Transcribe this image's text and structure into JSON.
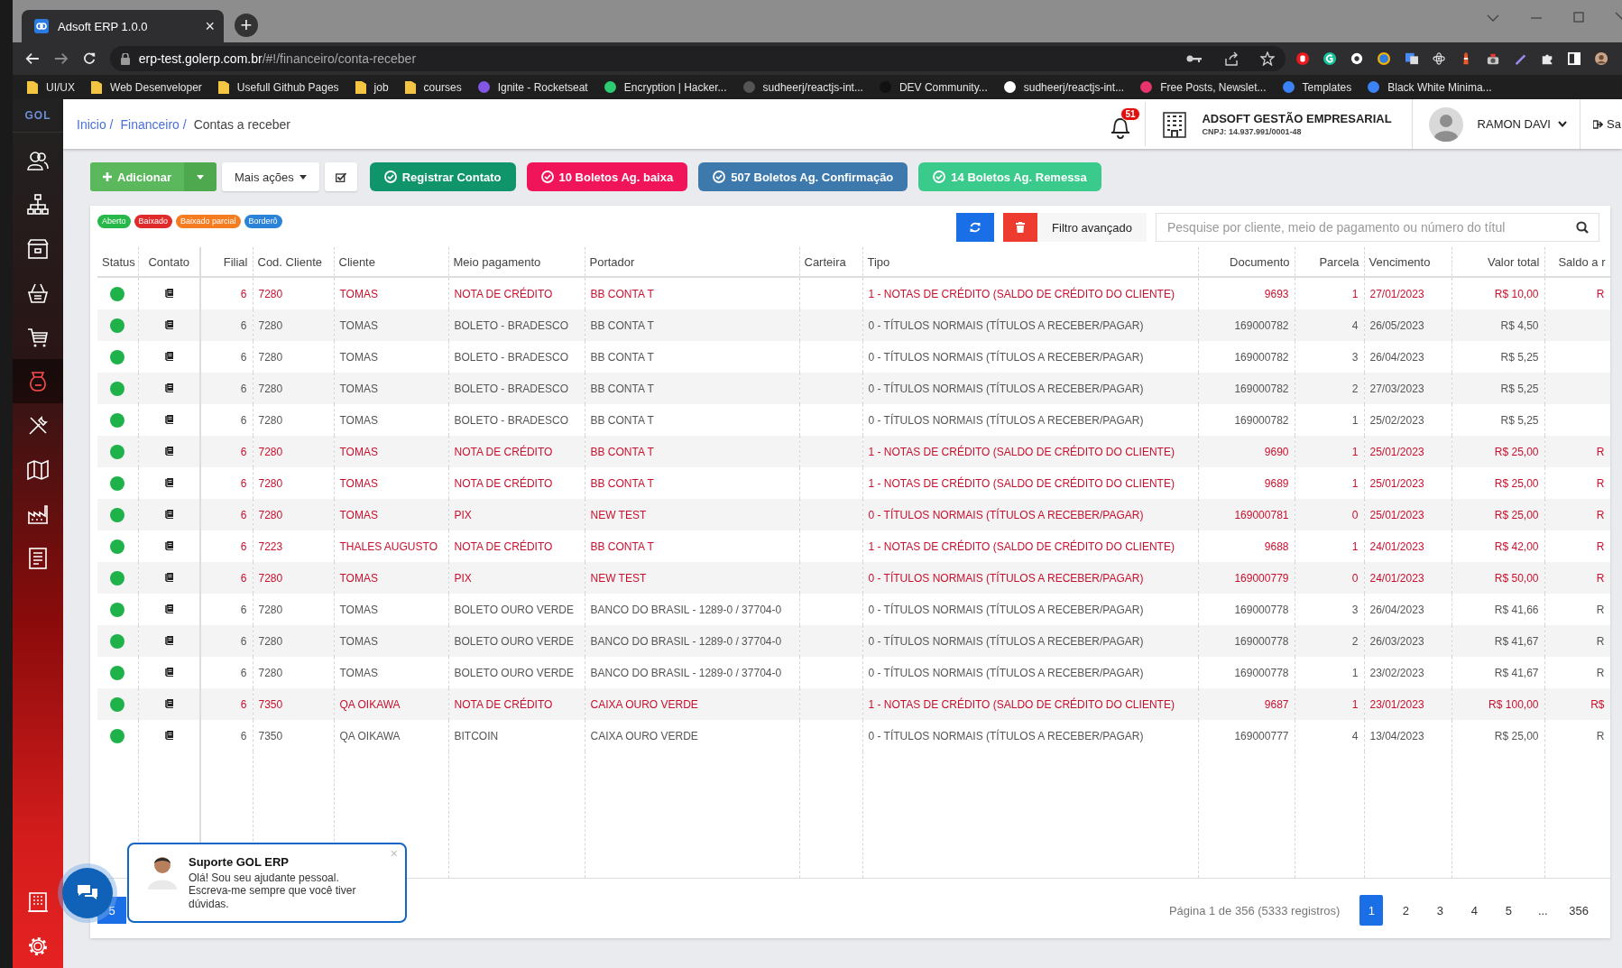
{
  "browser": {
    "tab_title": "Adsoft ERP 1.0.0",
    "tab_close": "×",
    "new_tab": "+",
    "url_host": "erp-test.golerp.com.br",
    "url_path": "/#!/financeiro/conta-receber",
    "bookmarks": [
      {
        "label": "UI/UX",
        "kind": "folder"
      },
      {
        "label": "Web Desenveloper",
        "kind": "folder"
      },
      {
        "label": "Usefull Github Pages",
        "kind": "folder"
      },
      {
        "label": "job",
        "kind": "folder"
      },
      {
        "label": "courses",
        "kind": "folder"
      },
      {
        "label": "Ignite - Rocketseat",
        "kind": "site",
        "color": "#8257e5"
      },
      {
        "label": "Encryption | Hacker...",
        "kind": "site",
        "color": "#2ecc71"
      },
      {
        "label": "sudheerj/reactjs-int...",
        "kind": "site",
        "color": "#555555"
      },
      {
        "label": "DEV Community...",
        "kind": "site",
        "color": "#111111"
      },
      {
        "label": "sudheerj/reactjs-int...",
        "kind": "site",
        "color": "#ffffff"
      },
      {
        "label": "Free Posts, Newslet...",
        "kind": "site",
        "color": "#e8336d"
      },
      {
        "label": "Templates",
        "kind": "site",
        "color": "#3b82f6"
      },
      {
        "label": "Black White Minima...",
        "kind": "site",
        "color": "#3b82f6"
      }
    ]
  },
  "sidebar": {
    "logo": "GOL",
    "items": [
      {
        "selected": false
      },
      {
        "selected": false
      },
      {
        "selected": false
      },
      {
        "selected": false
      },
      {
        "selected": false
      },
      {
        "selected": true
      },
      {
        "selected": false
      },
      {
        "selected": false
      },
      {
        "selected": false
      },
      {
        "selected": false
      }
    ],
    "bottom_items": [
      {
        "selected": false
      },
      {
        "selected": false
      }
    ]
  },
  "breadcrumb": [
    {
      "label": "Inicio /",
      "link": true
    },
    {
      "label": "Financeiro /",
      "link": true
    },
    {
      "label": "Contas a receber",
      "link": false
    }
  ],
  "header": {
    "notifications": "51",
    "company": "ADSOFT GESTÃO EMPRESARIAL",
    "cnpj": "CNPJ: 14.937.991/0001-48",
    "user": "RAMON DAVI",
    "logout": "Sa"
  },
  "toolbar": [
    {
      "label": "Adicionar",
      "kind": "split"
    },
    {
      "label": "Mais ações",
      "kind": "menu"
    },
    {
      "kind": "check"
    },
    {
      "label": "Registrar Contato",
      "kind": "action",
      "color": "#10956b"
    },
    {
      "label": "10 Boletos Ag. baixa",
      "kind": "action",
      "color": "#f0145a"
    },
    {
      "label": "507 Boletos Ag. Confirmação",
      "kind": "action",
      "color": "#3d79ac"
    },
    {
      "label": "14 Boletos Ag. Remessa",
      "kind": "action",
      "color": "#3acb8c"
    }
  ],
  "legend": [
    {
      "label": "Aberto",
      "color": "#28b84a"
    },
    {
      "label": "Baixado",
      "color": "#e02b2b"
    },
    {
      "label": "Baixado parcial",
      "color": "#f57c1f"
    },
    {
      "label": "Borderô",
      "color": "#2a83d6"
    }
  ],
  "filter": {
    "advanced": "Filtro avançado",
    "placeholder": "Pesquise por cliente, meio de pagamento ou número do títul"
  },
  "table": {
    "columns": [
      "Status",
      "Contato",
      "Filial",
      "Cod. Cliente",
      "Cliente",
      "Meio pagamento",
      "Portador",
      "Carteira",
      "Tipo",
      "Documento",
      "Parcela",
      "Vencimento",
      "Valor total",
      "Saldo a r"
    ],
    "rows": [
      {
        "color": "#1fb14a",
        "overdue": true,
        "filial": "6",
        "cod": "7280",
        "cliente": "TOMAS",
        "meio": "NOTA DE CRÉDITO",
        "portador": "BB CONTA T",
        "tipo": "1 - NOTAS DE CRÉDITO (SALDO DE CRÉDITO DO CLIENTE)",
        "documento": "9693",
        "parcela": "1",
        "vencimento": "27/01/2023",
        "valor": "R$ 10,00",
        "saldo": "R"
      },
      {
        "color": "#1fb14a",
        "overdue": false,
        "filial": "6",
        "cod": "7280",
        "cliente": "TOMAS",
        "meio": "BOLETO - BRADESCO",
        "portador": "BB CONTA T",
        "tipo": "0 - TÍTULOS NORMAIS (TÍTULOS A RECEBER/PAGAR)",
        "documento": "169000782",
        "parcela": "4",
        "vencimento": "26/05/2023",
        "valor": "R$ 4,50"
      },
      {
        "color": "#1fb14a",
        "overdue": false,
        "filial": "6",
        "cod": "7280",
        "cliente": "TOMAS",
        "meio": "BOLETO - BRADESCO",
        "portador": "BB CONTA T",
        "tipo": "0 - TÍTULOS NORMAIS (TÍTULOS A RECEBER/PAGAR)",
        "documento": "169000782",
        "parcela": "3",
        "vencimento": "26/04/2023",
        "valor": "R$ 5,25"
      },
      {
        "color": "#1fb14a",
        "overdue": false,
        "filial": "6",
        "cod": "7280",
        "cliente": "TOMAS",
        "meio": "BOLETO - BRADESCO",
        "portador": "BB CONTA T",
        "tipo": "0 - TÍTULOS NORMAIS (TÍTULOS A RECEBER/PAGAR)",
        "documento": "169000782",
        "parcela": "2",
        "vencimento": "27/03/2023",
        "valor": "R$ 5,25"
      },
      {
        "color": "#1fb14a",
        "overdue": false,
        "filial": "6",
        "cod": "7280",
        "cliente": "TOMAS",
        "meio": "BOLETO - BRADESCO",
        "portador": "BB CONTA T",
        "tipo": "0 - TÍTULOS NORMAIS (TÍTULOS A RECEBER/PAGAR)",
        "documento": "169000782",
        "parcela": "1",
        "vencimento": "25/02/2023",
        "valor": "R$ 5,25"
      },
      {
        "color": "#1fb14a",
        "overdue": true,
        "filial": "6",
        "cod": "7280",
        "cliente": "TOMAS",
        "meio": "NOTA DE CRÉDITO",
        "portador": "BB CONTA T",
        "tipo": "1 - NOTAS DE CRÉDITO (SALDO DE CRÉDITO DO CLIENTE)",
        "documento": "9690",
        "parcela": "1",
        "vencimento": "25/01/2023",
        "valor": "R$ 25,00",
        "saldo": "R"
      },
      {
        "color": "#1fb14a",
        "overdue": true,
        "filial": "6",
        "cod": "7280",
        "cliente": "TOMAS",
        "meio": "NOTA DE CRÉDITO",
        "portador": "BB CONTA T",
        "tipo": "1 - NOTAS DE CRÉDITO (SALDO DE CRÉDITO DO CLIENTE)",
        "documento": "9689",
        "parcela": "1",
        "vencimento": "25/01/2023",
        "valor": "R$ 25,00",
        "saldo": "R"
      },
      {
        "color": "#1fb14a",
        "overdue": true,
        "filial": "6",
        "cod": "7280",
        "cliente": "TOMAS",
        "meio": "PIX",
        "portador": "NEW TEST",
        "tipo": "0 - TÍTULOS NORMAIS (TÍTULOS A RECEBER/PAGAR)",
        "documento": "169000781",
        "parcela": "0",
        "vencimento": "25/01/2023",
        "valor": "R$ 25,00",
        "saldo": "R"
      },
      {
        "color": "#1fb14a",
        "overdue": true,
        "filial": "6",
        "cod": "7223",
        "cliente": "THALES AUGUSTO",
        "meio": "NOTA DE CRÉDITO",
        "portador": "BB CONTA T",
        "tipo": "1 - NOTAS DE CRÉDITO (SALDO DE CRÉDITO DO CLIENTE)",
        "documento": "9688",
        "parcela": "1",
        "vencimento": "24/01/2023",
        "valor": "R$ 42,00",
        "saldo": "R"
      },
      {
        "color": "#1fb14a",
        "overdue": true,
        "filial": "6",
        "cod": "7280",
        "cliente": "TOMAS",
        "meio": "PIX",
        "portador": "NEW TEST",
        "tipo": "0 - TÍTULOS NORMAIS (TÍTULOS A RECEBER/PAGAR)",
        "documento": "169000779",
        "parcela": "0",
        "vencimento": "24/01/2023",
        "valor": "R$ 50,00",
        "saldo": "R"
      },
      {
        "color": "#1fb14a",
        "overdue": false,
        "filial": "6",
        "cod": "7280",
        "cliente": "TOMAS",
        "meio": "BOLETO OURO VERDE",
        "portador": "BANCO DO BRASIL - 1289-0 / 37704-0",
        "tipo": "0 - TÍTULOS NORMAIS (TÍTULOS A RECEBER/PAGAR)",
        "documento": "169000778",
        "parcela": "3",
        "vencimento": "26/04/2023",
        "valor": "R$ 41,66",
        "saldo": "R"
      },
      {
        "color": "#1fb14a",
        "overdue": false,
        "filial": "6",
        "cod": "7280",
        "cliente": "TOMAS",
        "meio": "BOLETO OURO VERDE",
        "portador": "BANCO DO BRASIL - 1289-0 / 37704-0",
        "tipo": "0 - TÍTULOS NORMAIS (TÍTULOS A RECEBER/PAGAR)",
        "documento": "169000778",
        "parcela": "2",
        "vencimento": "26/03/2023",
        "valor": "R$ 41,67",
        "saldo": "R"
      },
      {
        "color": "#1fb14a",
        "overdue": false,
        "filial": "6",
        "cod": "7280",
        "cliente": "TOMAS",
        "meio": "BOLETO OURO VERDE",
        "portador": "BANCO DO BRASIL - 1289-0 / 37704-0",
        "tipo": "0 - TÍTULOS NORMAIS (TÍTULOS A RECEBER/PAGAR)",
        "documento": "169000778",
        "parcela": "1",
        "vencimento": "23/02/2023",
        "valor": "R$ 41,67",
        "saldo": "R"
      },
      {
        "color": "#1fb14a",
        "overdue": true,
        "filial": "6",
        "cod": "7350",
        "cliente": "QA OIKAWA",
        "meio": "NOTA DE CRÉDITO",
        "portador": "CAIXA OURO VERDE",
        "tipo": "1 - NOTAS DE CRÉDITO (SALDO DE CRÉDITO DO CLIENTE)",
        "documento": "9687",
        "parcela": "1",
        "vencimento": "23/01/2023",
        "valor": "R$ 100,00",
        "saldo": "R$"
      },
      {
        "color": "#1fb14a",
        "overdue": false,
        "filial": "6",
        "cod": "7350",
        "cliente": "QA OIKAWA",
        "meio": "BITCOIN",
        "portador": "CAIXA OURO VERDE",
        "tipo": "0 - TÍTULOS NORMAIS (TÍTULOS A RECEBER/PAGAR)",
        "documento": "169000777",
        "parcela": "4",
        "vencimento": "13/04/2023",
        "valor": "R$ 25,00",
        "saldo": "R"
      }
    ]
  },
  "pagination": {
    "page_size": "5",
    "info": "Página 1 de 356 (5333 registros)",
    "pages": [
      {
        "label": "1",
        "selected": true
      },
      {
        "label": "2",
        "selected": false
      },
      {
        "label": "3",
        "selected": false
      },
      {
        "label": "4",
        "selected": false
      },
      {
        "label": "5",
        "selected": false
      },
      {
        "label": "...",
        "selected": false
      },
      {
        "label": "356",
        "selected": false
      }
    ]
  },
  "chat": {
    "title": "Suporte GOL ERP",
    "message": "Olá! Sou seu ajudante pessoal. Escreva-me sempre que você tiver dúvidas.",
    "close": "×"
  }
}
